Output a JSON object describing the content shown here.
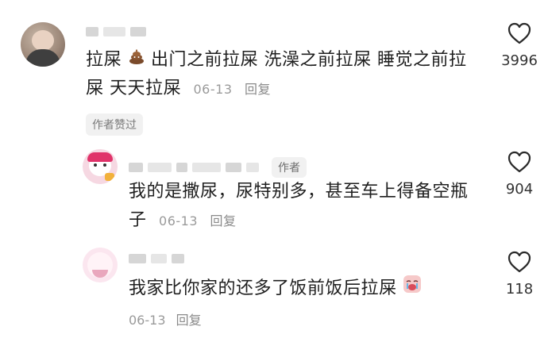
{
  "comments": [
    {
      "text_line1": "拉屎",
      "text_line1_rest": " 出门之前拉屎 洗澡之前拉屎 睡觉之前拉",
      "text_line2": "屎 天天拉屎",
      "date": "06-13",
      "reply_label": "回复",
      "chip_label": "作者赞过",
      "like_count": "3996",
      "icon": "poop-emoji-icon"
    },
    {
      "author_tag": "作者",
      "text_line1": "我的是撒尿，尿特别多，甚至车上得备空瓶",
      "text_line2": "子",
      "date": "06-13",
      "reply_label": "回复",
      "like_count": "904"
    },
    {
      "text_line1": "我家比你家的还多了饭前饭后拉屎",
      "date": "06-13",
      "reply_label": "回复",
      "like_count": "118",
      "icon": "crying-emoji-icon"
    }
  ],
  "colors": {
    "text": "#1f1f1f",
    "meta": "#9a9a9a",
    "chip_bg": "#f1f1f1"
  }
}
